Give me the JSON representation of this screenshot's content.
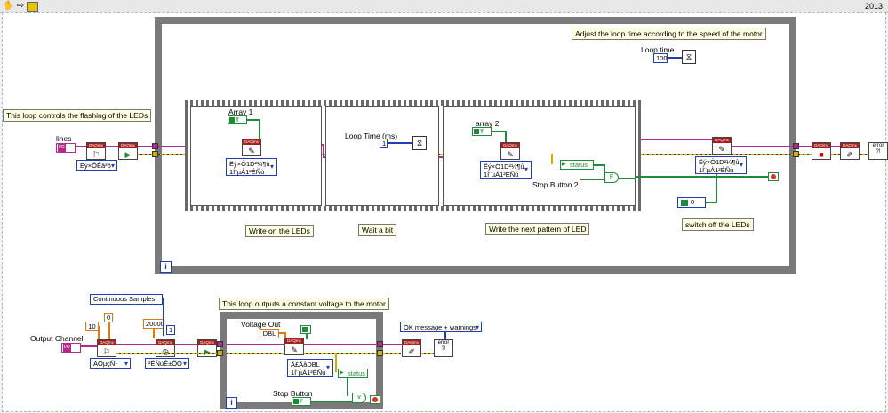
{
  "toolbar": {
    "run_icon": "hand-cursor-icon",
    "arrow_icon": "arrow-right-icon",
    "highlight_icon": "highlight-icon",
    "version": "2013"
  },
  "comments": {
    "leds_loop": "This loop controls the flashing of the LEDs",
    "adjust_time": "Adjust the loop time according to the speed of the motor",
    "write_leds": "Write on the LEDs",
    "wait_bit": "Wait a bit",
    "write_next": "Write the next pattern of LED",
    "switch_off": "switch off the LEDs",
    "voltage_loop": "This loop outputs a constant voltage to the motor"
  },
  "labels": {
    "lines": "lines",
    "array1": "Array 1",
    "loop_time_ms": "Loop Time (ms)",
    "array2": "array 2",
    "loop_time": "Loop time",
    "stop_button_2": "Stop Button 2",
    "status": "status",
    "output_channel": "Output Channel",
    "voltage_out": "Voltage Out",
    "stop_button": "Stop Button",
    "status2": "status"
  },
  "constants": {
    "loop_time_value": "100",
    "continuous_samples": "Continuous Samples",
    "num_zero": "0",
    "num_ten": "10",
    "num_20000": "20000",
    "num_one": "1",
    "tf_true": "T",
    "tf_false": "F",
    "ok_message": "OK message + warnings",
    "loop_time_ms_value": "1"
  },
  "polymorphic": {
    "create_do": "Ëý×ÖÊä³ö",
    "write_dig_1a": "Ëý×Ö1D²¼¶û",
    "write_dig_1b": "1Í¨µÀ1²ÉÑù",
    "write_dig_2a": "Ëý×Ö1D²¼¶û",
    "write_dig_2b": "1Í¨µÀ1²ÉÑù",
    "write_dig_3a": "Ëý×Ö1D²¼¶û",
    "write_dig_3b": "1Í¨µÀ1²ÉÑù",
    "create_ao": "AOµçÑ¹",
    "timing": "²ÉÑùÊ±ÖÓ",
    "write_an_a": "Ä£ÄâDBL",
    "write_an_b": "1Í¨µÀ1²ÉÑù"
  },
  "daq_header": "DAQmx",
  "loop_iter": "i",
  "colors": {
    "boolean": "#1f8a3a",
    "integer": "#1f3fb0",
    "daq_task": "#b7288d",
    "error": "#c8b400",
    "float": "#e07a10"
  }
}
